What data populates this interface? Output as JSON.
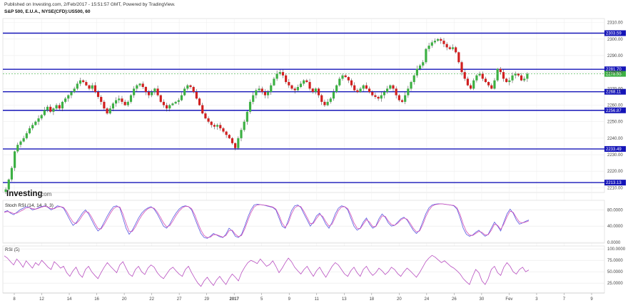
{
  "header": {
    "published": "Published on Investing.com, 2/Feb/2017 - 15:51:57 GMT, Powered by TradingView.",
    "symbol": "S&P 500, E.U.A., NYSE(CFD):US500, 60"
  },
  "logo": {
    "brand": "Investing",
    "suffix": ".com"
  },
  "panels": {
    "stoch_label": "Stoch RSI (14, 14, 3, 3)",
    "rsi_label": "RSI (5)"
  },
  "colors": {
    "up": "#3cb043",
    "down": "#d11f1f",
    "hline": "#1515b8",
    "current": "#3cb043",
    "stoch_k": "#5a5ae0",
    "stoch_d": "#d24fb8",
    "rsi": "#b84fc0"
  },
  "chart_data": [
    {
      "type": "candlestick",
      "title": "S&P 500, E.U.A., NYSE(CFD):US500, 60",
      "ylim": [
        2208,
        2312
      ],
      "y_ticks": [
        2210.0,
        2220.0,
        2230.0,
        2240.0,
        2250.0,
        2260.0,
        2270.0,
        2280.0,
        2290.0,
        2300.0,
        2310.0
      ],
      "x_ticks": [
        "8",
        "12",
        "14",
        "16",
        "20",
        "22",
        "27",
        "29",
        "2017",
        "5",
        "9",
        "11",
        "13",
        "18",
        "20",
        "24",
        "26",
        "30",
        "Fev",
        "3",
        "7",
        "9"
      ],
      "grid": true,
      "horizontal_levels": [
        2303.59,
        2281.7,
        2268.11,
        2256.87,
        2233.49,
        2213.13
      ],
      "current_price": 2278.95,
      "ohlc_anchors": [
        2209,
        2215,
        2222,
        2232,
        2236,
        2238,
        2240,
        2243,
        2246,
        2248,
        2250,
        2252,
        2254,
        2257,
        2259,
        2256,
        2258,
        2260,
        2258,
        2262,
        2264,
        2266,
        2268,
        2270,
        2273,
        2275,
        2274,
        2272,
        2270,
        2272,
        2268,
        2265,
        2262,
        2258,
        2255,
        2258,
        2261,
        2263,
        2264,
        2262,
        2260,
        2262,
        2266,
        2270,
        2272,
        2273,
        2271,
        2268,
        2266,
        2268,
        2270,
        2266,
        2262,
        2260,
        2258,
        2260,
        2261,
        2262,
        2263,
        2266,
        2270,
        2272,
        2271,
        2268,
        2264,
        2260,
        2255,
        2252,
        2250,
        2248,
        2247,
        2248,
        2246,
        2244,
        2242,
        2240,
        2237,
        2234,
        2240,
        2245,
        2250,
        2256,
        2262,
        2266,
        2269,
        2270,
        2268,
        2266,
        2268,
        2272,
        2276,
        2279,
        2280,
        2278,
        2274,
        2272,
        2270,
        2269,
        2271,
        2273,
        2275,
        2274,
        2270,
        2268,
        2270,
        2266,
        2262,
        2260,
        2262,
        2264,
        2268,
        2272,
        2276,
        2278,
        2277,
        2275,
        2272,
        2269,
        2268,
        2270,
        2272,
        2270,
        2268,
        2266,
        2265,
        2264,
        2266,
        2268,
        2270,
        2272,
        2270,
        2266,
        2263,
        2262,
        2266,
        2270,
        2274,
        2278,
        2282,
        2284,
        2286,
        2294,
        2296,
        2298,
        2299,
        2300,
        2299,
        2297,
        2295,
        2294,
        2295,
        2292,
        2286,
        2280,
        2276,
        2272,
        2270,
        2275,
        2278,
        2279,
        2276,
        2274,
        2272,
        2270,
        2275,
        2282,
        2280,
        2276,
        2274,
        2275,
        2278,
        2279,
        2278,
        2275,
        2276,
        2279
      ]
    },
    {
      "type": "line",
      "title": "Stoch RSI (14, 14, 3, 3)",
      "ylim": [
        0,
        100
      ],
      "y_ticks": [
        "0.0000",
        "40.0000",
        "80.0000"
      ],
      "series": [
        {
          "values": [
            75,
            78,
            72,
            68,
            74,
            80,
            84,
            88,
            86,
            80,
            82,
            86,
            88,
            90,
            86,
            80,
            84,
            90,
            88,
            84,
            70,
            55,
            42,
            48,
            60,
            72,
            80,
            70,
            55,
            40,
            28,
            35,
            50,
            65,
            78,
            88,
            90,
            85,
            60,
            35,
            20,
            30,
            45,
            60,
            72,
            80,
            85,
            88,
            82,
            70,
            55,
            40,
            35,
            45,
            60,
            72,
            82,
            88,
            90,
            88,
            80,
            60,
            40,
            22,
            12,
            10,
            15,
            22,
            18,
            14,
            12,
            20,
            35,
            28,
            15,
            12,
            20,
            40,
            62,
            80,
            92,
            94,
            93,
            92,
            90,
            88,
            86,
            80,
            60,
            40,
            35,
            55,
            78,
            90,
            92,
            86,
            70,
            55,
            40,
            50,
            65,
            72,
            60,
            45,
            35,
            50,
            70,
            84,
            90,
            88,
            80,
            60,
            40,
            30,
            35,
            50,
            60,
            45,
            35,
            40,
            58,
            70,
            62,
            48,
            40,
            42,
            50,
            58,
            62,
            55,
            42,
            30,
            22,
            30,
            50,
            70,
            85,
            92,
            94,
            95,
            95,
            94,
            93,
            92,
            90,
            82,
            60,
            35,
            20,
            15,
            18,
            25,
            30,
            22,
            15,
            20,
            35,
            50,
            40,
            28,
            50,
            70,
            82,
            72,
            55,
            45,
            48,
            52,
            55
          ]
        },
        {
          "values": [
            74,
            76,
            74,
            71,
            72,
            76,
            80,
            85,
            86,
            83,
            82,
            84,
            87,
            89,
            87,
            83,
            83,
            87,
            88,
            86,
            76,
            62,
            50,
            46,
            54,
            66,
            76,
            74,
            62,
            47,
            34,
            33,
            44,
            58,
            72,
            83,
            88,
            87,
            70,
            47,
            27,
            27,
            38,
            53,
            66,
            76,
            83,
            86,
            84,
            75,
            62,
            48,
            38,
            41,
            53,
            66,
            77,
            85,
            89,
            88,
            83,
            68,
            48,
            30,
            17,
            12,
            13,
            19,
            19,
            16,
            13,
            17,
            29,
            30,
            20,
            14,
            17,
            33,
            54,
            73,
            87,
            92,
            93,
            92,
            91,
            89,
            87,
            82,
            67,
            47,
            37,
            48,
            70,
            85,
            90,
            88,
            76,
            61,
            46,
            47,
            59,
            69,
            64,
            51,
            40,
            45,
            62,
            78,
            87,
            88,
            83,
            68,
            48,
            35,
            34,
            45,
            56,
            50,
            39,
            39,
            52,
            65,
            64,
            53,
            44,
            42,
            47,
            55,
            60,
            57,
            47,
            35,
            26,
            28,
            43,
            63,
            79,
            89,
            93,
            94,
            95,
            94,
            93,
            92,
            91,
            85,
            68,
            45,
            27,
            18,
            17,
            22,
            27,
            25,
            18,
            19,
            30,
            45,
            42,
            32,
            45,
            63,
            77,
            74,
            61,
            50,
            48,
            50,
            53
          ]
        }
      ]
    },
    {
      "type": "line",
      "title": "RSI (5)",
      "ylim": [
        5,
        105
      ],
      "y_ticks": [
        "25.0000",
        "50.0000",
        "75.0000",
        "100.0000"
      ],
      "series": [
        {
          "values": [
            85,
            80,
            72,
            65,
            78,
            70,
            60,
            74,
            66,
            58,
            70,
            64,
            75,
            68,
            60,
            55,
            72,
            66,
            58,
            62,
            48,
            40,
            52,
            60,
            45,
            38,
            55,
            62,
            50,
            42,
            35,
            48,
            60,
            70,
            62,
            55,
            48,
            65,
            72,
            58,
            45,
            40,
            55,
            62,
            50,
            44,
            58,
            65,
            60,
            48,
            40,
            35,
            45,
            55,
            60,
            52,
            45,
            40,
            55,
            62,
            48,
            36,
            25,
            18,
            30,
            38,
            28,
            20,
            32,
            40,
            30,
            22,
            35,
            45,
            38,
            30,
            48,
            60,
            70,
            75,
            72,
            68,
            78,
            70,
            62,
            66,
            74,
            62,
            48,
            58,
            70,
            80,
            72,
            60,
            52,
            45,
            55,
            62,
            50,
            40,
            52,
            60,
            48,
            38,
            50,
            62,
            70,
            65,
            55,
            45,
            40,
            52,
            60,
            48,
            40,
            55,
            62,
            50,
            42,
            48,
            58,
            52,
            44,
            50,
            60,
            55,
            46,
            40,
            50,
            58,
            52,
            45,
            38,
            48,
            60,
            72,
            80,
            86,
            82,
            76,
            70,
            74,
            68,
            62,
            58,
            52,
            45,
            35,
            28,
            22,
            40,
            55,
            48,
            30,
            22,
            35,
            55,
            62,
            48,
            42,
            60,
            70,
            62,
            50,
            45,
            55,
            60,
            50,
            54
          ]
        }
      ]
    }
  ]
}
